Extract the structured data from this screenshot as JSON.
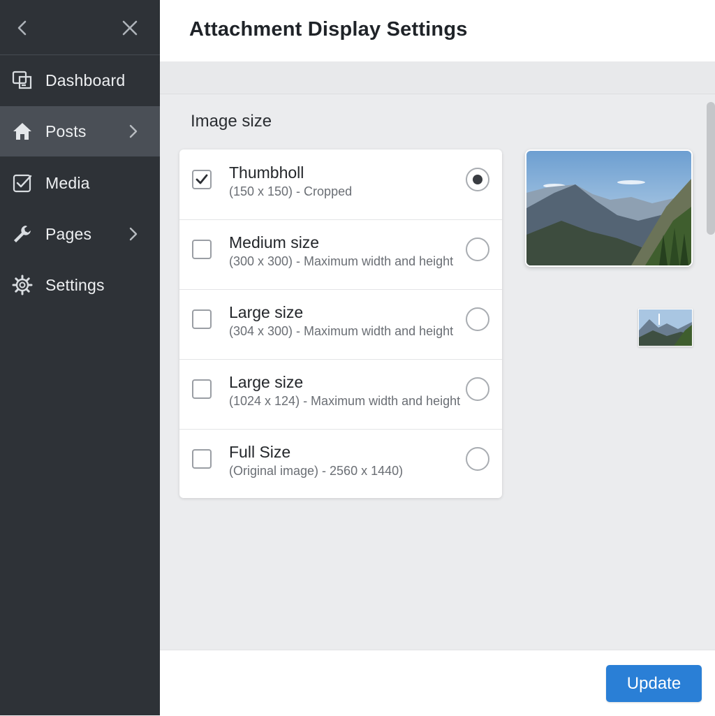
{
  "window": {
    "title": "Attachment Display Settings"
  },
  "sidebar": {
    "back_icon": "chevron-left-icon",
    "close_icon": "close-icon",
    "items": [
      {
        "label": "Dashboard",
        "icon": "dashboard-icon",
        "active": false,
        "has_submenu": false
      },
      {
        "label": "Posts",
        "icon": "home-icon",
        "active": true,
        "has_submenu": true
      },
      {
        "label": "Media",
        "icon": "checkbox-icon",
        "active": false,
        "has_submenu": false
      },
      {
        "label": "Pages",
        "icon": "wrench-icon",
        "active": false,
        "has_submenu": true
      },
      {
        "label": "Settings",
        "icon": "gear-icon",
        "active": false,
        "has_submenu": false
      }
    ]
  },
  "section": {
    "title": "Image size"
  },
  "sizes": [
    {
      "title": "Thumbholl",
      "subtitle": "(150 x 150) - Cropped",
      "checked": true,
      "selected": true
    },
    {
      "title": "Medium size",
      "subtitle": "(300 x 300) - Maximum width and height",
      "checked": false,
      "selected": false
    },
    {
      "title": "Large size",
      "subtitle": "(304 x 300) - Maximum width and height",
      "checked": false,
      "selected": false
    },
    {
      "title": "Large size",
      "subtitle": "(1024 x 124) - Maximum width and height",
      "checked": false,
      "selected": false
    },
    {
      "title": "Full Size",
      "subtitle": "(Original image) - 2560 x 1440)",
      "checked": false,
      "selected": false
    }
  ],
  "preview": {
    "large_image": "mountain-landscape-image",
    "small_image": "mountain-thumbnail-image"
  },
  "footer": {
    "update_label": "Update"
  },
  "colors": {
    "sidebar_bg": "#2e3237",
    "sidebar_active": "#4a4f56",
    "accent": "#2a7fd6",
    "content_bg": "#ebecee"
  }
}
